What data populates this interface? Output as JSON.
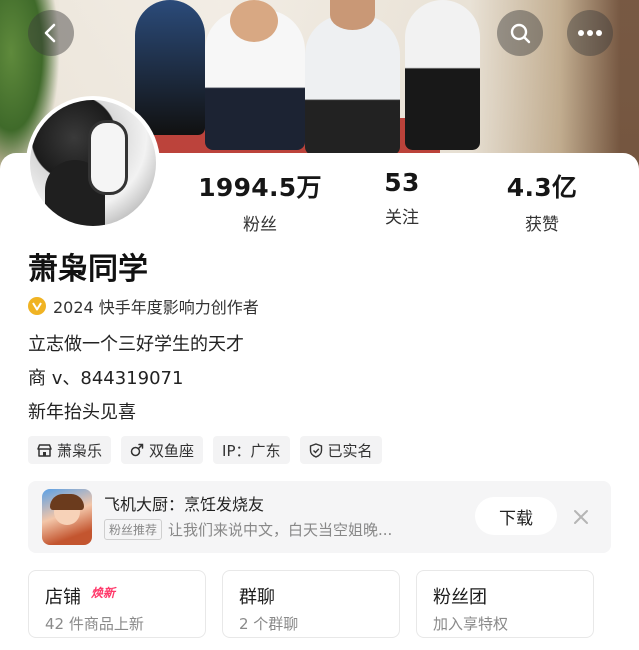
{
  "nav": {
    "back_icon": "chevron-left-icon",
    "search_icon": "search-icon",
    "more_icon": "more-dots-icon"
  },
  "profile": {
    "name": "萧枭同学",
    "badge": "2024 快手年度影响力创作者",
    "bio": [
      "立志做一个三好学生的天才",
      "商 v、844319071",
      "新年抬头见喜"
    ]
  },
  "stats": [
    {
      "value": "1994.5万",
      "label": "粉丝"
    },
    {
      "value": "53",
      "label": "关注"
    },
    {
      "value": "4.3亿",
      "label": "获赞"
    }
  ],
  "tags": [
    {
      "icon": "shop-icon",
      "label": "萧枭乐"
    },
    {
      "icon": "male-icon",
      "label": "双鱼座"
    },
    {
      "icon": "",
      "label": "IP：广东"
    },
    {
      "icon": "shield-check-icon",
      "label": "已实名"
    }
  ],
  "promo": {
    "title": "飞机大厨：烹饪发烧友",
    "tag": "粉丝推荐",
    "desc": "让我们来说中文，白天当空姐晚...",
    "download_label": "下载"
  },
  "cards": [
    {
      "title": "店铺",
      "badge": "焕新",
      "sub": "42 件商品上新"
    },
    {
      "title": "群聊",
      "badge": "",
      "sub": "2 个群聊"
    },
    {
      "title": "粉丝团",
      "badge": "",
      "sub": "加入享特权"
    }
  ],
  "colors": {
    "verified_badge": "#f0b323",
    "new_badge": "#ff3a6b",
    "tag_bg": "#f3f3f4"
  }
}
